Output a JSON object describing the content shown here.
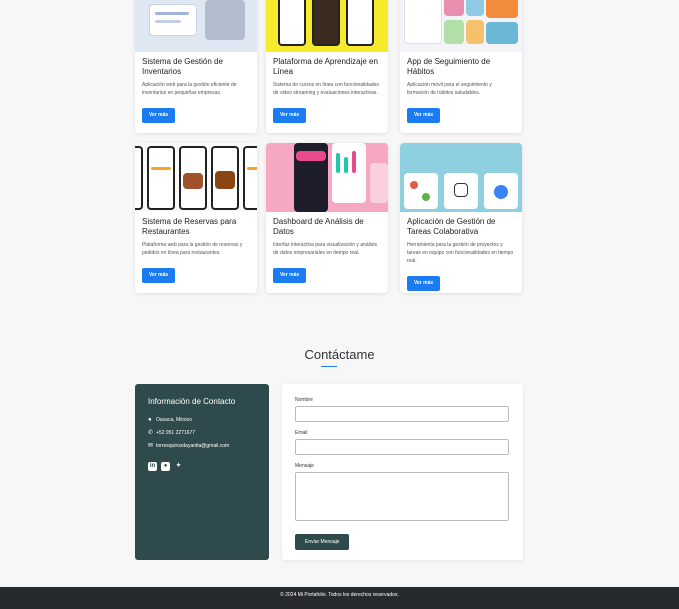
{
  "projects": [
    {
      "title": "Sistema de Gestión de Inventarios",
      "desc": "Aplicación web para la gestión eficiente de inventarios en pequeñas empresas.",
      "button": "Ver más"
    },
    {
      "title": "Plataforma de Aprendizaje en Línea",
      "desc": "Sistema de cursos en línea con funcionalidades de video streaming y evaluaciones interactivas.",
      "button": "Ver más"
    },
    {
      "title": "App de Seguimiento de Hábitos",
      "desc": "Aplicación móvil para el seguimiento y formación de hábitos saludables.",
      "button": "Ver más"
    },
    {
      "title": "Sistema de Reservas para Restaurantes",
      "desc": "Plataforma web para la gestión de reservas y pedidos en línea para restaurantes.",
      "button": "Ver más"
    },
    {
      "title": "Dashboard de Análisis de Datos",
      "desc": "Interfaz interactiva para visualización y análisis de datos empresariales en tiempo real.",
      "button": "Ver más"
    },
    {
      "title": "Aplicación de Gestión de Tareas Colaborativa",
      "desc": "Herramienta para la gestión de proyectos y tareas en equipo con funcionalidades en tiempo real.",
      "button": "Ver más"
    }
  ],
  "contact": {
    "title": "Contáctame",
    "info_title": "Información de Contacto",
    "location": "Oaxaca, México",
    "phone": "+52 951 2271677",
    "email": "torresquirozdayanita@gmail.com",
    "socials": [
      "linkedin-icon",
      "github-icon",
      "twitter-icon"
    ]
  },
  "form": {
    "name_label": "Nombre",
    "email_label": "Email",
    "message_label": "Mensaje",
    "submit_label": "Enviar Mensaje"
  },
  "footer": {
    "text": "© 2024 Mi Portafolio. Todos los derechos reservados."
  },
  "colors": {
    "accent": "#1a7cf0",
    "panel": "#2f4a4c",
    "footer": "#262a2d"
  }
}
